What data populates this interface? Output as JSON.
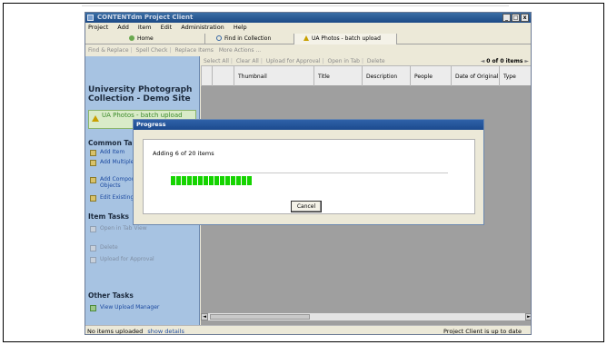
{
  "window": {
    "title": "CONTENTdm Project Client",
    "buttons": [
      "_",
      "□",
      "x"
    ]
  },
  "menu": {
    "items": [
      "Project",
      "Add",
      "Item",
      "Edit",
      "Administration",
      "Help"
    ]
  },
  "nav_tabs": [
    {
      "label": "Home",
      "icon": "home-icon"
    },
    {
      "label": "Find in Collection",
      "icon": "search-icon"
    },
    {
      "label": "UA Photos - batch upload",
      "icon": "warning-icon"
    }
  ],
  "command_bar": {
    "items": [
      "Find & Replace",
      "Spell Check",
      "Replace Items",
      "More Actions ..."
    ]
  },
  "sidebar": {
    "collection_title": "University Photograph Collection - Demo Site",
    "batch_panel": "UA Photos - batch upload",
    "common_heading": "Common Tasks",
    "common_tasks": [
      "Add Item",
      "Add Multiple Items",
      "Add Compound Objects",
      "Edit Existing Items"
    ],
    "item_heading": "Item Tasks",
    "item_tasks": [
      "Open in Tab View",
      "Delete",
      "Upload for Approval"
    ],
    "other_heading": "Other Tasks",
    "other_tasks": [
      "View Upload Manager"
    ]
  },
  "grid": {
    "toolbar": [
      "Select All",
      "Clear All",
      "Upload for Approval",
      "Open in Tab",
      "Delete"
    ],
    "pager": {
      "prefix": "◄",
      "text": "0 of 0 items",
      "suffix": "►"
    },
    "columns": [
      "Thumbnail",
      "Title",
      "Description",
      "People",
      "Date of Original",
      "Type"
    ]
  },
  "status": {
    "left": "No items uploaded",
    "link": "show details",
    "right": "Project Client is up to date"
  },
  "dialog": {
    "title": "Progress",
    "message": "Adding 6 of 20 items",
    "progress_current": 6,
    "progress_total": 20,
    "cancel_label": "Cancel"
  },
  "colors": {
    "progress": "#15d400",
    "sidebar": "#a7c3e2",
    "titlebar": "#1c4a86"
  }
}
